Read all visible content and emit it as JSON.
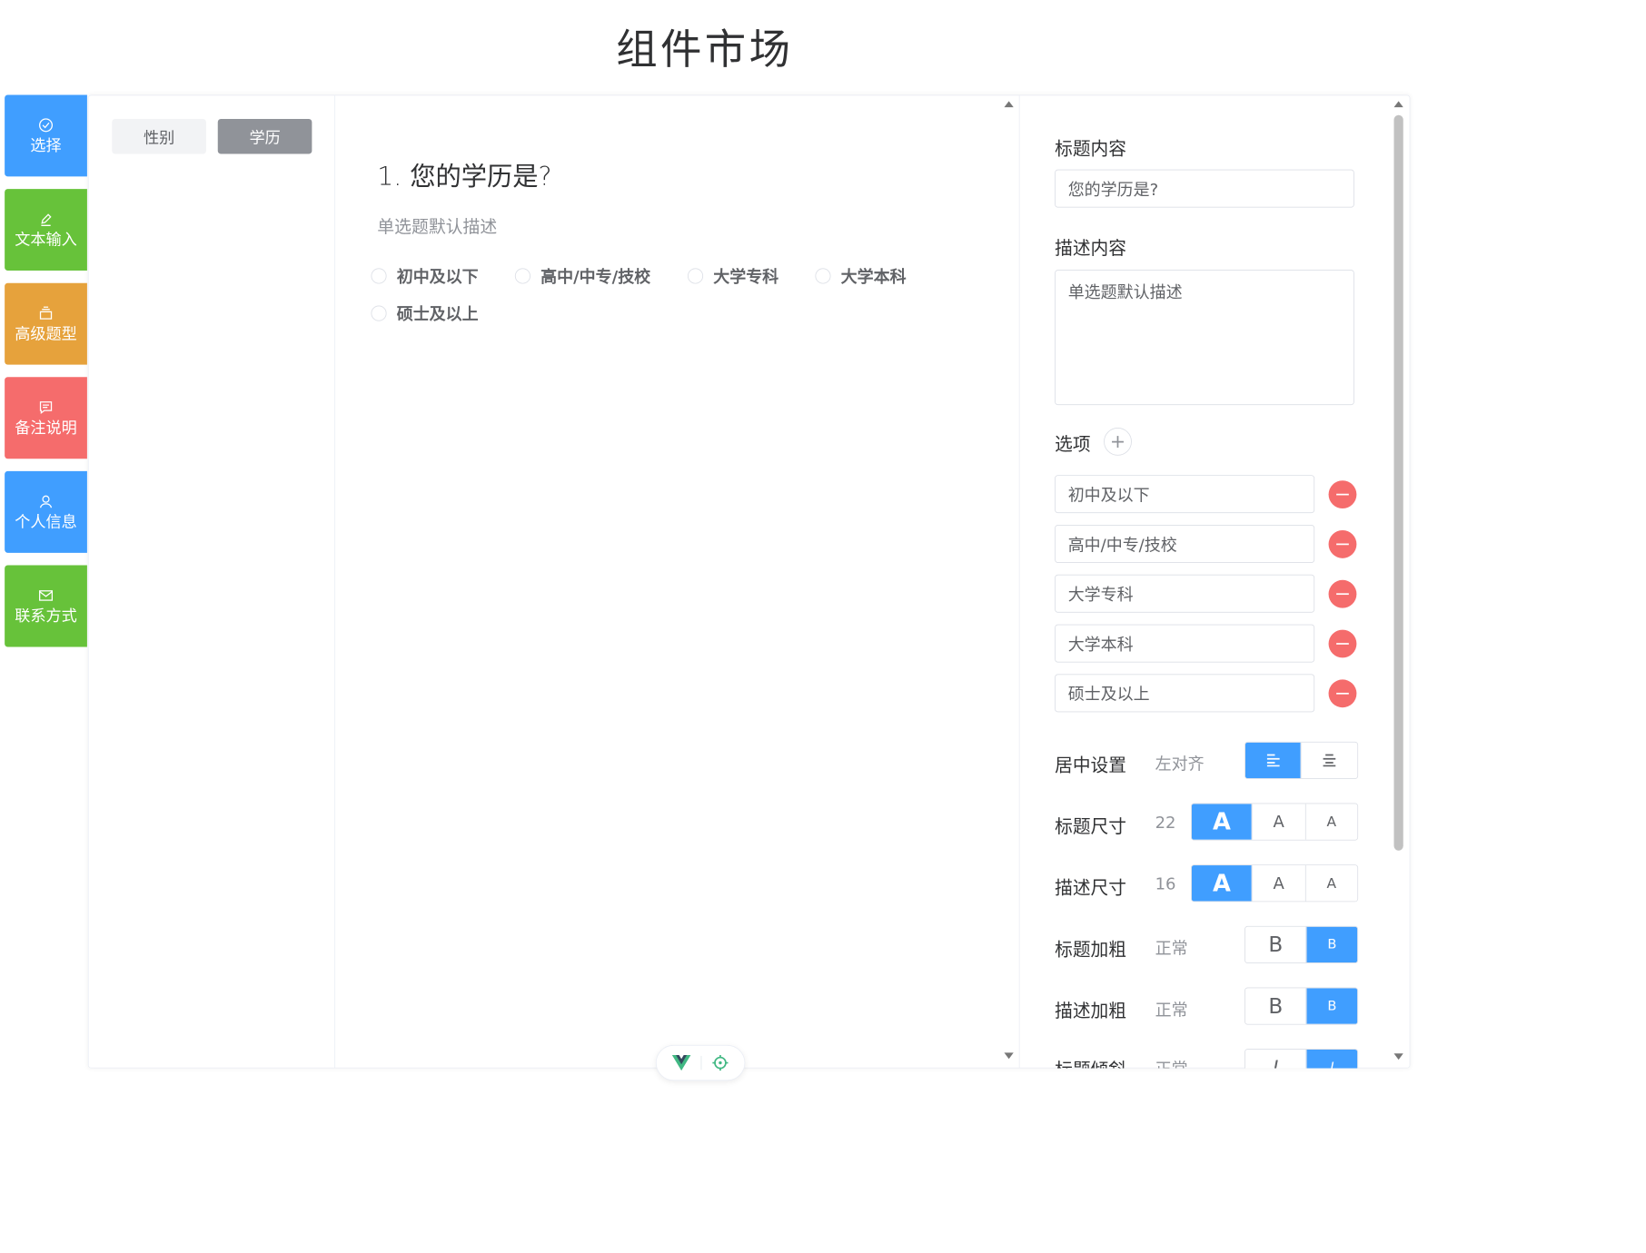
{
  "page_title": "组件市场",
  "nav": [
    {
      "label": "选择",
      "icon": "check-circle-icon",
      "color": "#409eff"
    },
    {
      "label": "文本输入",
      "icon": "edit-pen-icon",
      "color": "#67c23a"
    },
    {
      "label": "高级题型",
      "icon": "box-icon",
      "color": "#e6a23c"
    },
    {
      "label": "备注说明",
      "icon": "comment-icon",
      "color": "#f56c6c"
    },
    {
      "label": "个人信息",
      "icon": "user-icon",
      "color": "#409eff"
    },
    {
      "label": "联系方式",
      "icon": "mail-icon",
      "color": "#67c23a"
    }
  ],
  "components": {
    "chip_gender": "性别",
    "chip_education": "学历"
  },
  "question": {
    "title": "1. 您的学历是?",
    "description": "单选题默认描述",
    "options": [
      "初中及以下",
      "高中/中专/技校",
      "大学专科",
      "大学本科",
      "硕士及以上"
    ]
  },
  "props": {
    "title_label": "标题内容",
    "title_value": "您的学历是?",
    "desc_label": "描述内容",
    "desc_value": "单选题默认描述",
    "options_label": "选项",
    "options": [
      "初中及以下",
      "高中/中专/技校",
      "大学专科",
      "大学本科",
      "硕士及以上"
    ],
    "align_label": "居中设置",
    "align_value": "左对齐",
    "title_size_label": "标题尺寸",
    "title_size_value": "22",
    "desc_size_label": "描述尺寸",
    "desc_size_value": "16",
    "title_bold_label": "标题加粗",
    "title_bold_value": "正常",
    "desc_bold_label": "描述加粗",
    "desc_bold_value": "正常",
    "title_italic_label": "标题倾斜",
    "title_italic_value": "正常",
    "size_glyph": "A",
    "bold_glyph": "B",
    "italic_glyph": "I"
  },
  "accent_color": "#409eff",
  "danger_color": "#f56c6c"
}
